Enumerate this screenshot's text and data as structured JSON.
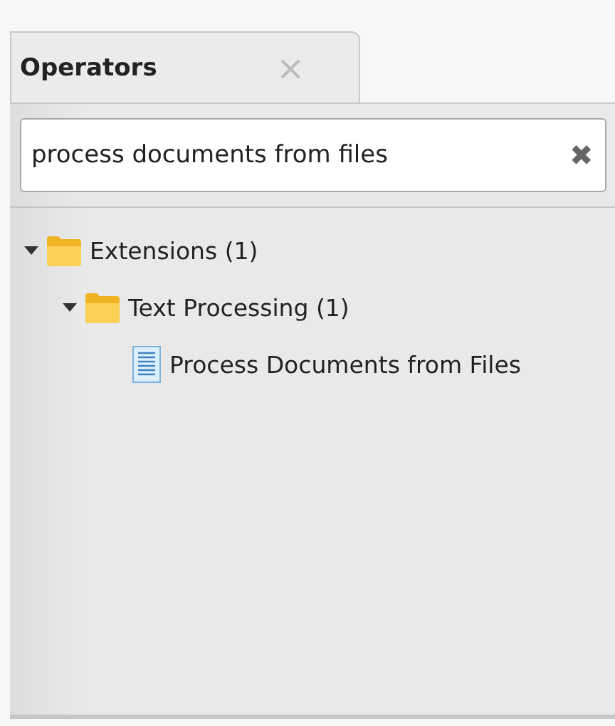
{
  "tab": {
    "title": "Operators",
    "close": "×",
    "selected": true
  },
  "search": {
    "value": "process documents from files",
    "clear": "✖"
  },
  "tree": [
    {
      "kind": "folder",
      "label": "Extensions (1)",
      "expanded": true,
      "children": [
        {
          "kind": "folder",
          "label": "Text Processing (1)",
          "expanded": true,
          "children": [
            {
              "kind": "operator",
              "label": "Process Documents from Files"
            }
          ]
        }
      ]
    }
  ]
}
